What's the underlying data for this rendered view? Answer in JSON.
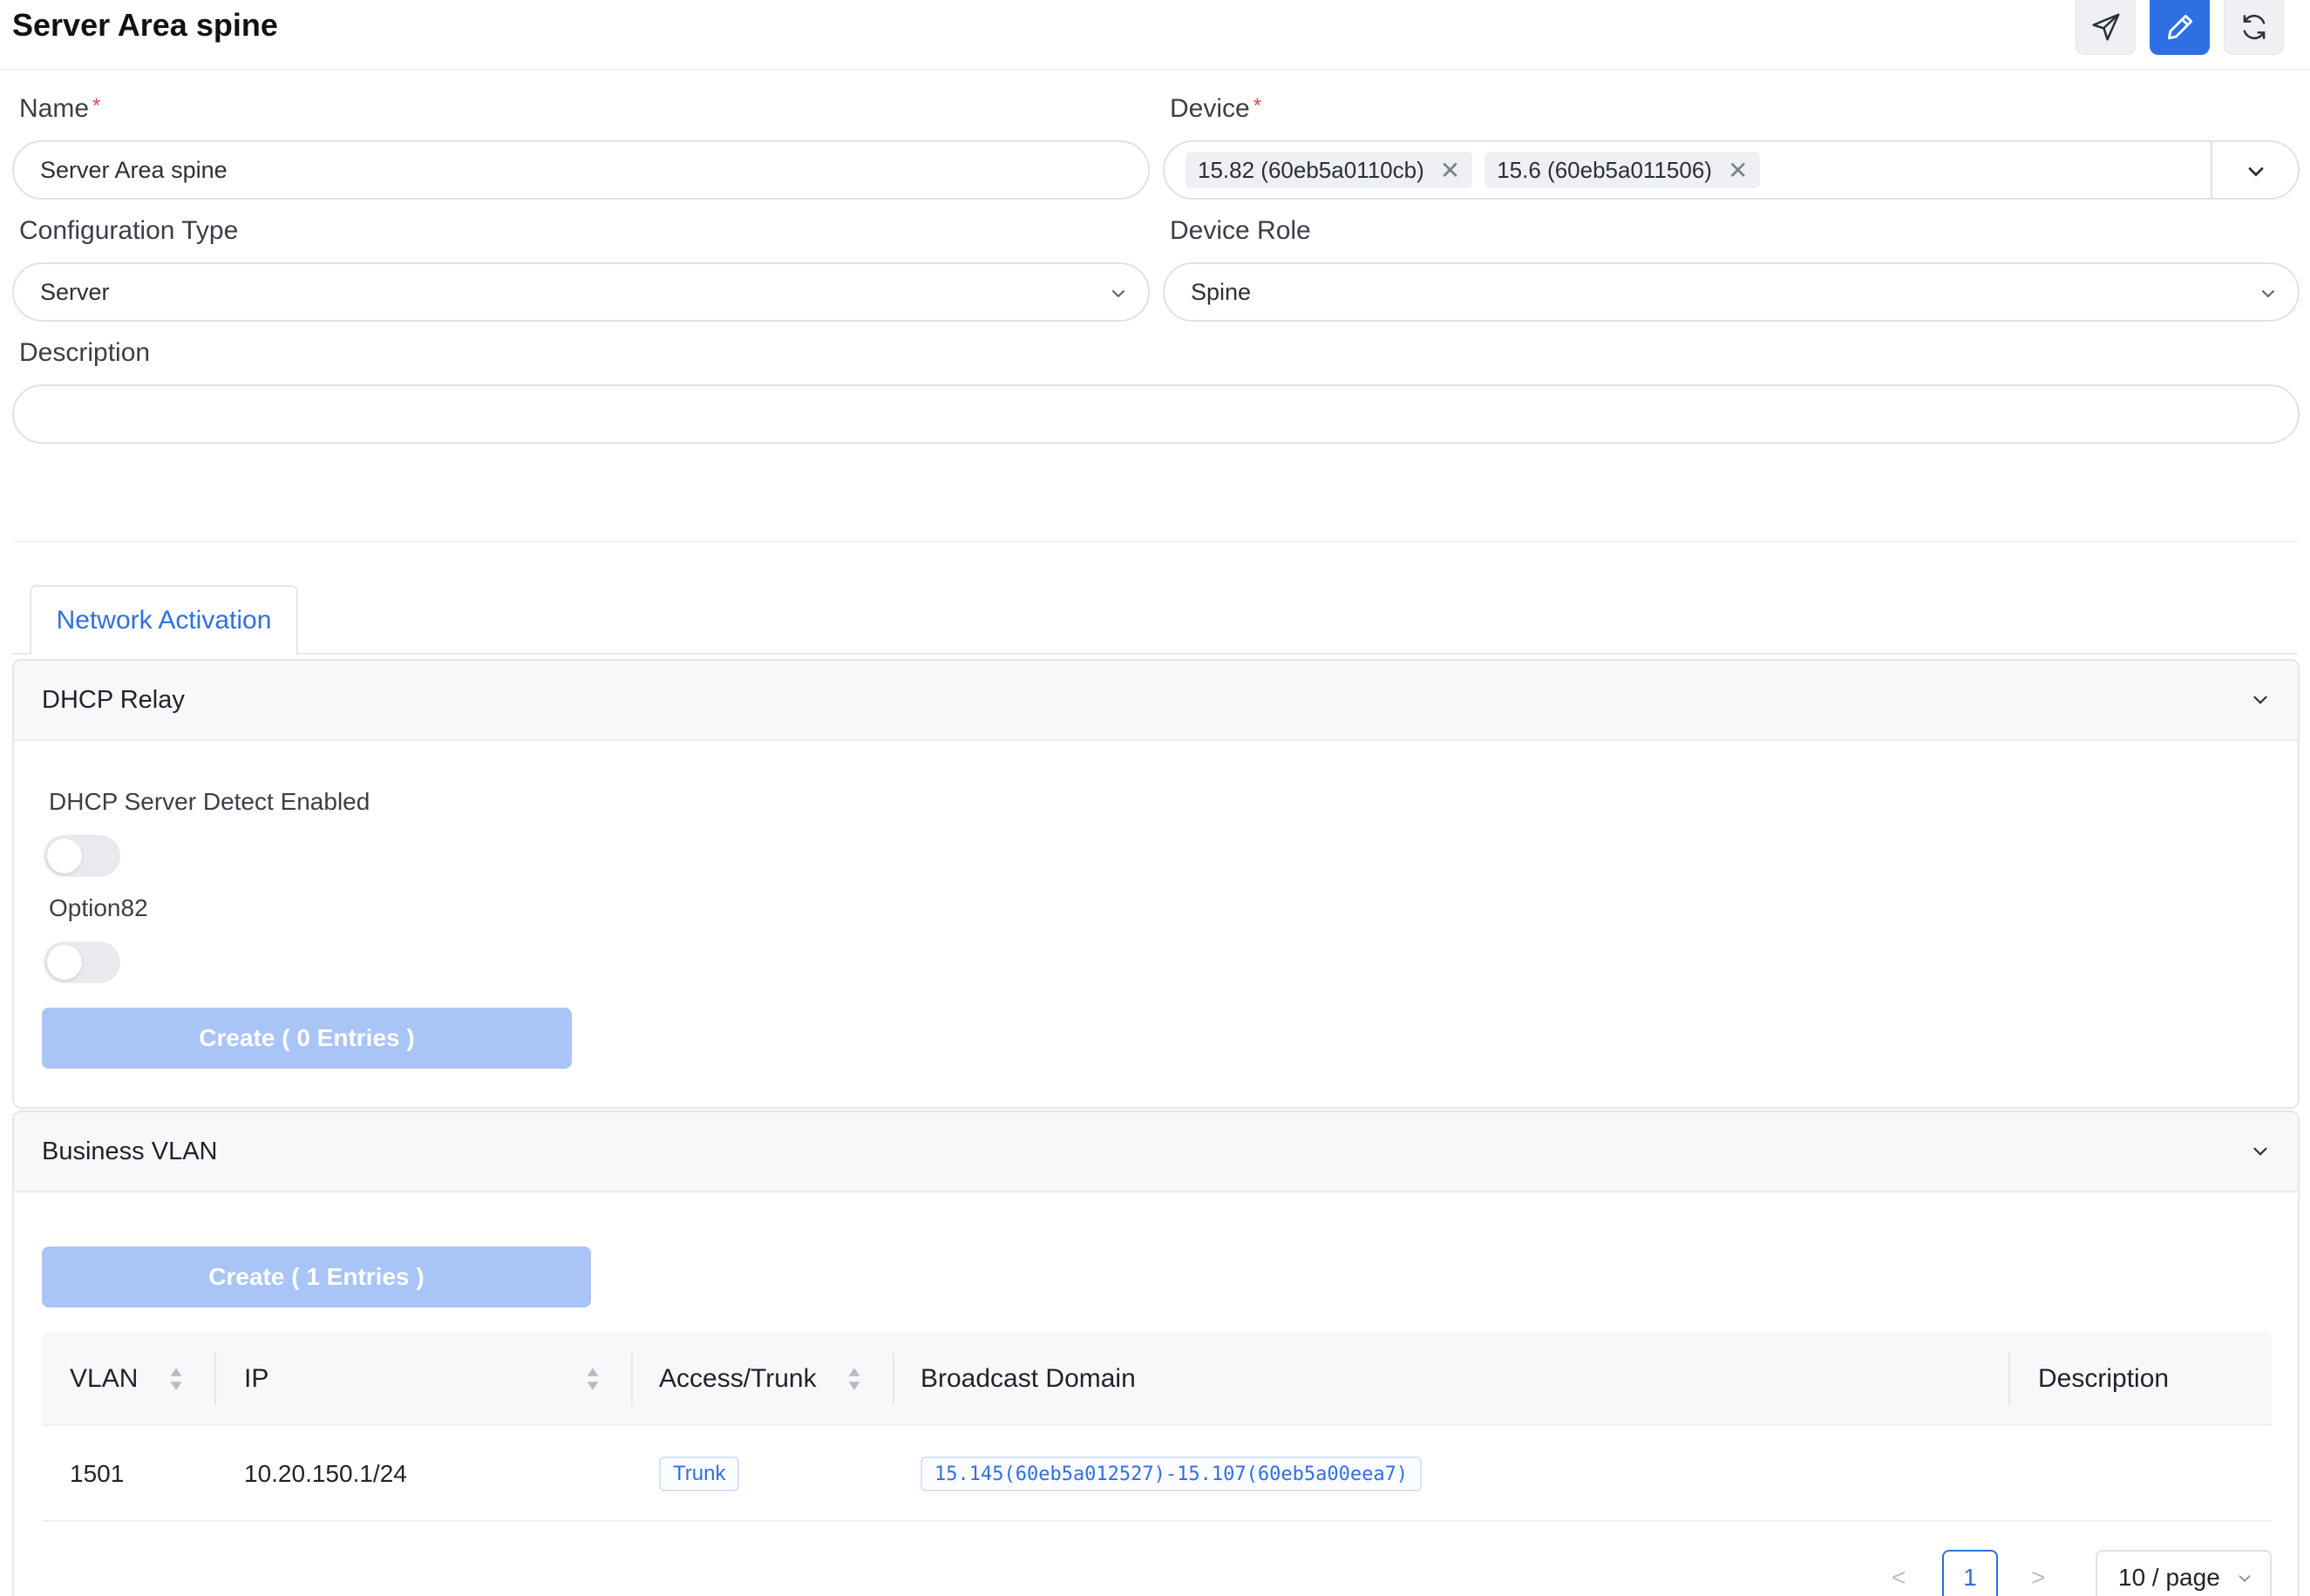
{
  "header": {
    "title": "Server Area spine",
    "actions": [
      {
        "icon": "send-icon",
        "label": "Deploy"
      },
      {
        "icon": "edit-icon",
        "label": "Edit"
      },
      {
        "icon": "refresh-icon",
        "label": "Refresh"
      }
    ],
    "accent_color": "#2f6fe4"
  },
  "form": {
    "name": {
      "label": "Name",
      "required_mark": "*",
      "value": "Server Area spine"
    },
    "device": {
      "label": "Device",
      "required_mark": "*",
      "tags": [
        "15.82 (60eb5a0110cb)",
        "15.6 (60eb5a011506)"
      ],
      "remove_glyph": "✕"
    },
    "configuration_type": {
      "label": "Configuration Type",
      "value": "Server"
    },
    "device_role": {
      "label": "Device Role",
      "value": "Spine"
    },
    "description": {
      "label": "Description",
      "value": ""
    }
  },
  "tabs": [
    {
      "label": "Network Activation",
      "active": true
    }
  ],
  "dhcp_relay": {
    "title": "DHCP Relay",
    "switches": [
      {
        "label": "DHCP Server Detect Enabled",
        "on": false
      },
      {
        "label": "Option82",
        "on": false
      }
    ],
    "create_button": "Create ( 0 Entries )"
  },
  "business_vlan": {
    "title": "Business VLAN",
    "create_button": "Create ( 1 Entries )",
    "table": {
      "columns": [
        "VLAN",
        "IP",
        "Access/Trunk",
        "Broadcast Domain",
        "Description"
      ],
      "rows": [
        {
          "vlan": "1501",
          "ip": "10.20.150.1/24",
          "mode": "Trunk",
          "broadcast_domain": "15.145(60eb5a012527)-15.107(60eb5a00eea7)",
          "description": ""
        }
      ]
    },
    "pagination": {
      "prev": "<",
      "current_page": "1",
      "next": ">",
      "page_size": "10 / page"
    }
  }
}
